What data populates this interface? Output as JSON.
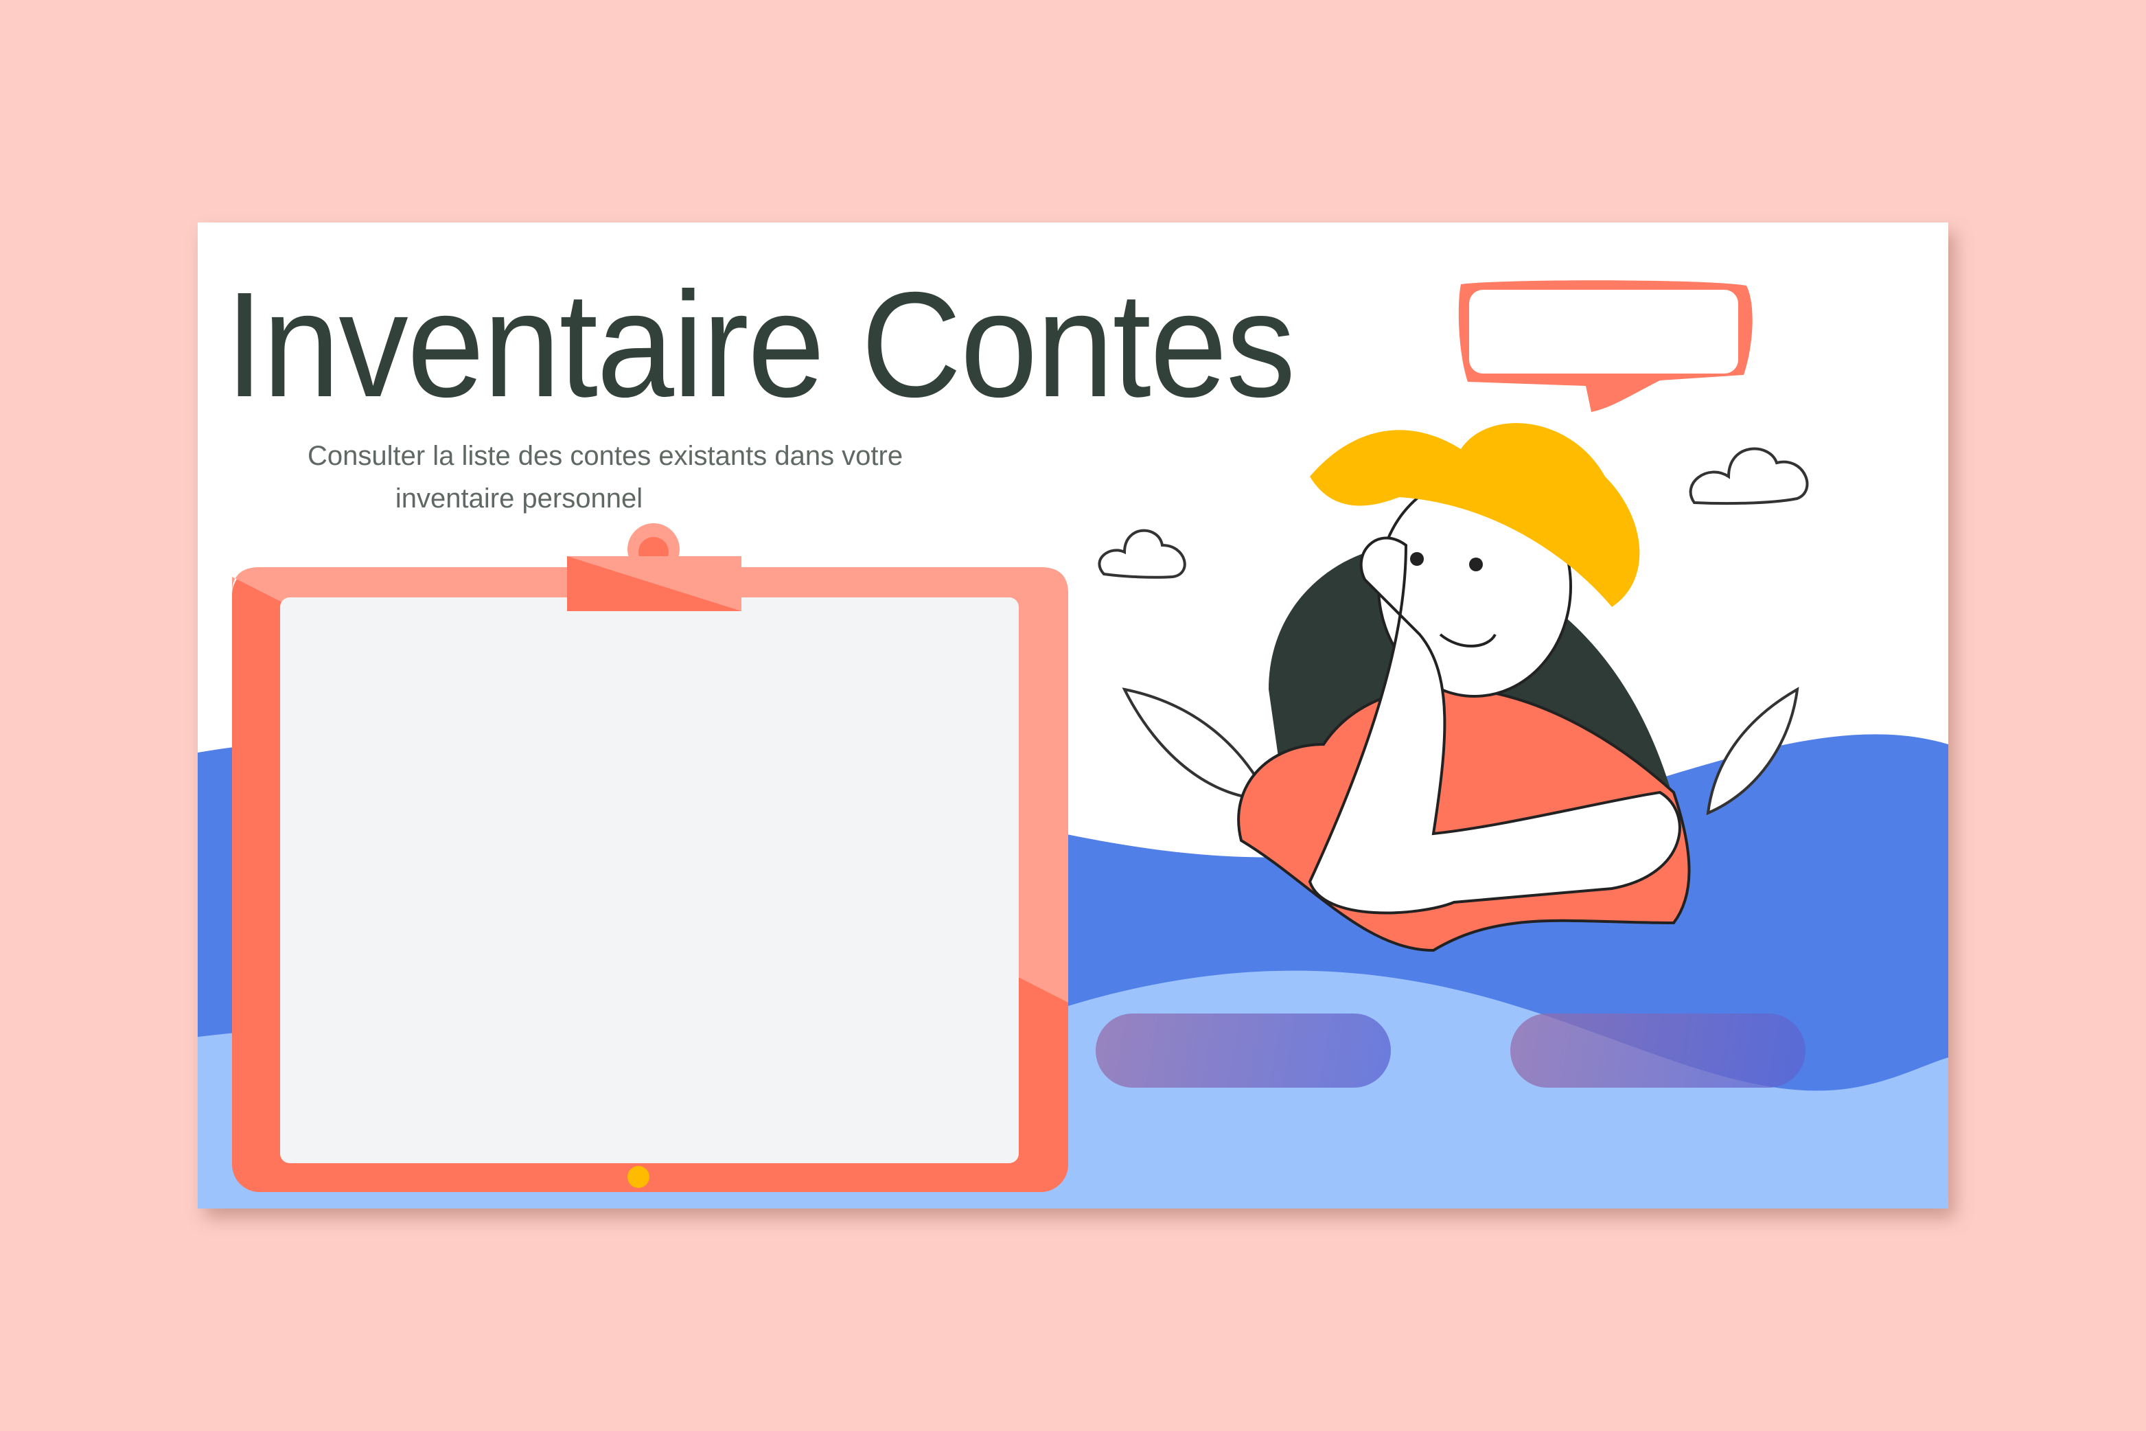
{
  "header": {
    "title": "Inventaire Contes",
    "subtitle_line1": "Consulter la liste des contes existants dans votre",
    "subtitle_line2": "inventaire personnel"
  },
  "colors": {
    "background": "#fecec6",
    "title": "#324139",
    "wave_dark": "#517fe8",
    "wave_light": "#9dc3fd",
    "tablet": "#ff755c",
    "tablet_light": "#ffa08e",
    "screen": "#f3f4f6",
    "hat": "#ffbb00"
  },
  "icons": [
    "tablet-illustration",
    "speech-bubble-icon",
    "girl-illustration",
    "cloud-icon",
    "leaf-icon"
  ]
}
